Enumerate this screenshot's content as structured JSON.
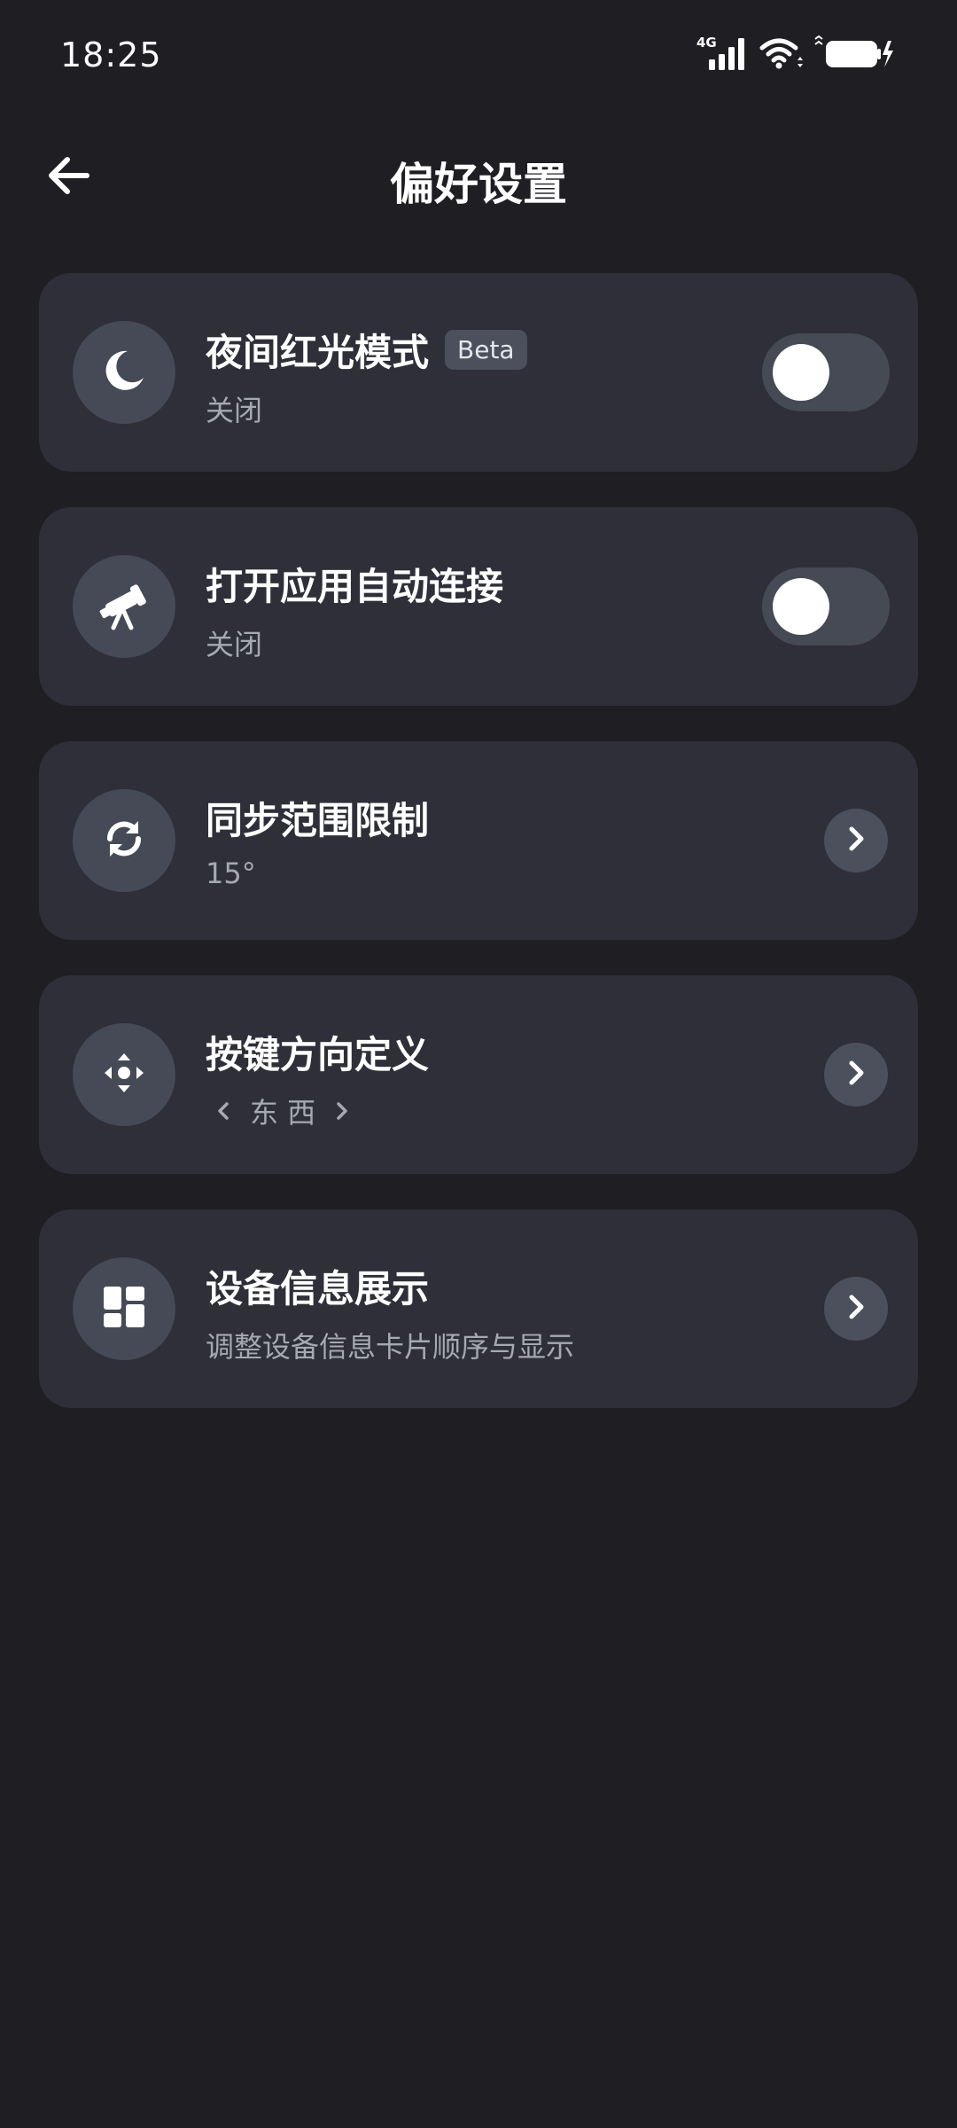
{
  "status_bar": {
    "time": "18:25",
    "network_label": "4G"
  },
  "header": {
    "title": "偏好设置",
    "back_icon": "arrow-left-icon"
  },
  "settings": [
    {
      "title": "夜间红光模式",
      "badge": "Beta",
      "subtitle": "关闭",
      "icon": "moon-icon",
      "control": "toggle",
      "toggle_on": false
    },
    {
      "title": "打开应用自动连接",
      "subtitle": "关闭",
      "icon": "telescope-icon",
      "control": "toggle",
      "toggle_on": false
    },
    {
      "title": "同步范围限制",
      "subtitle": "15°",
      "icon": "sync-icon",
      "control": "chevron"
    },
    {
      "title": "按键方向定义",
      "subtitle": "东 西",
      "icon": "dpad-icon",
      "control": "chevron"
    },
    {
      "title": "设备信息展示",
      "subtitle": "调整设备信息卡片顺序与显示",
      "icon": "dashboard-icon",
      "control": "chevron"
    }
  ],
  "colors": {
    "background": "#1e1e23",
    "card": "#2e2f38",
    "icon_circle": "#454a56",
    "toggle_track": "#464a55",
    "subtitle": "#a6a9b1"
  }
}
